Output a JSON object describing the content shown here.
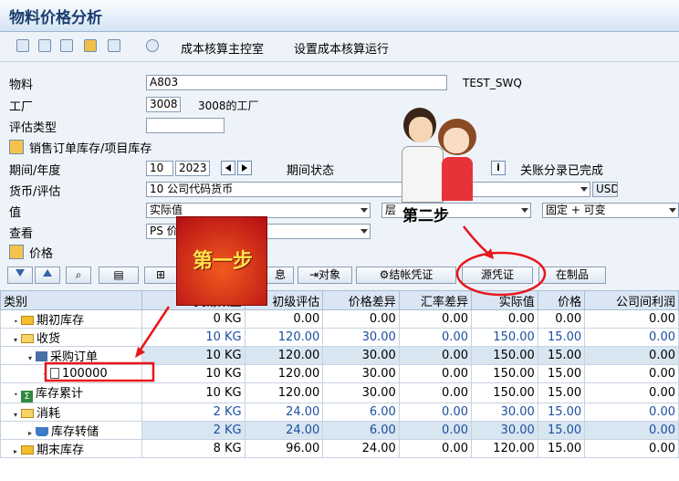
{
  "window": {
    "title": "物料价格分析"
  },
  "toolbar": {
    "link1": "成本核算主控室",
    "link2": "设置成本核算运行"
  },
  "form": {
    "material_label": "物料",
    "material_value": "A803",
    "material_desc": "TEST_SWQ",
    "plant_label": "工厂",
    "plant_value": "3008",
    "plant_desc": "3008的工厂",
    "valtype_label": "评估类型",
    "valtype_value": "",
    "sales_stock_label": "销售订单库存/项目库存",
    "period_label": "期间/年度",
    "period_value": "10",
    "year_value": "2023",
    "period_status_label": "期间状态",
    "closing_status": "关账分录已完成",
    "currency_label": "货币/评估",
    "currency_value": "10 公司代码货币",
    "currency_unit": "USD",
    "value_label": "值",
    "value_value": "实际值",
    "layer_value": "层",
    "fixed_variable": "固定 + 可变",
    "view_label": "查看",
    "view_value": "PS 价",
    "price_label": "价格"
  },
  "actions": {
    "info": "息",
    "object": "对象",
    "closing_doc": "结帐凭证",
    "source_doc": "源凭证",
    "wip": "在制品"
  },
  "grid": {
    "headers": [
      "类别",
      "交易数量",
      "初级评估",
      "价格差异",
      "汇率差异",
      "实际值",
      "价格",
      "公司间利润"
    ],
    "rows": [
      {
        "name": "期初库存",
        "qty": "0",
        "unit": "KG",
        "primary": "0.00",
        "price_diff": "0.00",
        "fx_diff": "0.00",
        "actual": "0.00",
        "price": "0.00",
        "ic_profit": "0.00"
      },
      {
        "name": "收货",
        "qty": "10",
        "unit": "KG",
        "primary": "120.00",
        "price_diff": "30.00",
        "fx_diff": "0.00",
        "actual": "150.00",
        "price": "15.00",
        "ic_profit": "0.00"
      },
      {
        "name": "采购订单",
        "qty": "10",
        "unit": "KG",
        "primary": "120.00",
        "price_diff": "30.00",
        "fx_diff": "0.00",
        "actual": "150.00",
        "price": "15.00",
        "ic_profit": "0.00"
      },
      {
        "name": "100000",
        "qty": "10",
        "unit": "KG",
        "primary": "120.00",
        "price_diff": "30.00",
        "fx_diff": "0.00",
        "actual": "150.00",
        "price": "15.00",
        "ic_profit": "0.00"
      },
      {
        "name": "库存累计",
        "qty": "10",
        "unit": "KG",
        "primary": "120.00",
        "price_diff": "30.00",
        "fx_diff": "0.00",
        "actual": "150.00",
        "price": "15.00",
        "ic_profit": "0.00"
      },
      {
        "name": "消耗",
        "qty": "2",
        "unit": "KG",
        "primary": "24.00",
        "price_diff": "6.00",
        "fx_diff": "0.00",
        "actual": "30.00",
        "price": "15.00",
        "ic_profit": "0.00"
      },
      {
        "name": "库存转储",
        "qty": "2",
        "unit": "KG",
        "primary": "24.00",
        "price_diff": "6.00",
        "fx_diff": "0.00",
        "actual": "30.00",
        "price": "15.00",
        "ic_profit": "0.00"
      },
      {
        "name": "期末库存",
        "qty": "8",
        "unit": "KG",
        "primary": "96.00",
        "price_diff": "24.00",
        "fx_diff": "0.00",
        "actual": "120.00",
        "price": "15.00",
        "ic_profit": "0.00"
      }
    ]
  },
  "annotations": {
    "step1": "第一步",
    "step2": "第二步"
  },
  "colors": {
    "accent_red": "#e8161c",
    "header_blue": "#dae6f3"
  }
}
